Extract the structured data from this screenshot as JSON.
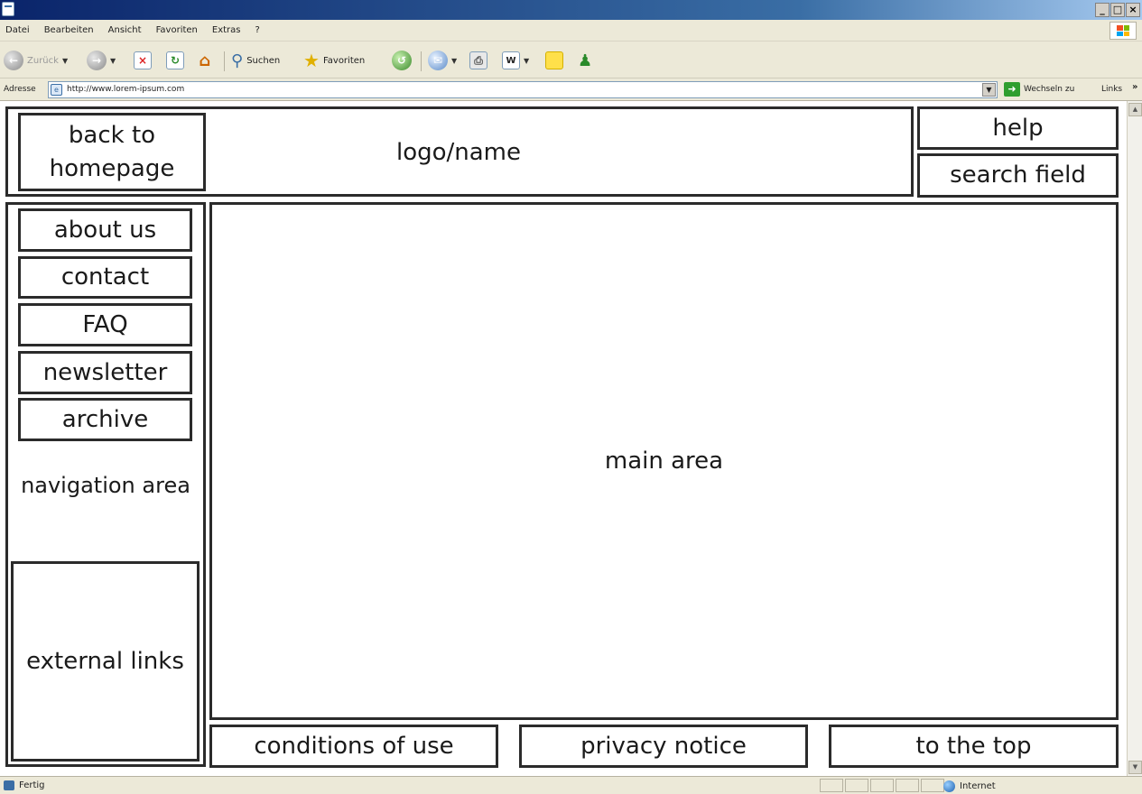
{
  "browser": {
    "window_controls": [
      "_",
      "×"
    ],
    "menu": [
      "Datei",
      "Bearbeiten",
      "Ansicht",
      "Favoriten",
      "Extras",
      "?"
    ],
    "toolbar": {
      "back_label": "Zurück",
      "search_label": "Suchen",
      "favorites_label": "Favoriten"
    },
    "address": {
      "label": "Adresse",
      "url": "http://www.lorem-ipsum.com",
      "go_label": "Wechseln zu",
      "links_label": "Links"
    },
    "status": {
      "text": "Fertig",
      "zone": "Internet"
    },
    "colors": {
      "titlebar": "#0a246a",
      "chrome": "#ece9d8",
      "wireframe_border": "#2b2b2b"
    }
  },
  "wireframe": {
    "header": {
      "back_to_homepage": "back to homepage",
      "logo": "logo/name",
      "help": "help",
      "search": "search field"
    },
    "navigation": {
      "items": [
        "about us",
        "contact",
        "FAQ",
        "newsletter",
        "archive"
      ],
      "area_label": "navigation area",
      "external_links": "external links"
    },
    "main_area": "main area",
    "footer": {
      "conditions": "conditions of use",
      "privacy": "privacy notice",
      "top": "to the top"
    }
  }
}
